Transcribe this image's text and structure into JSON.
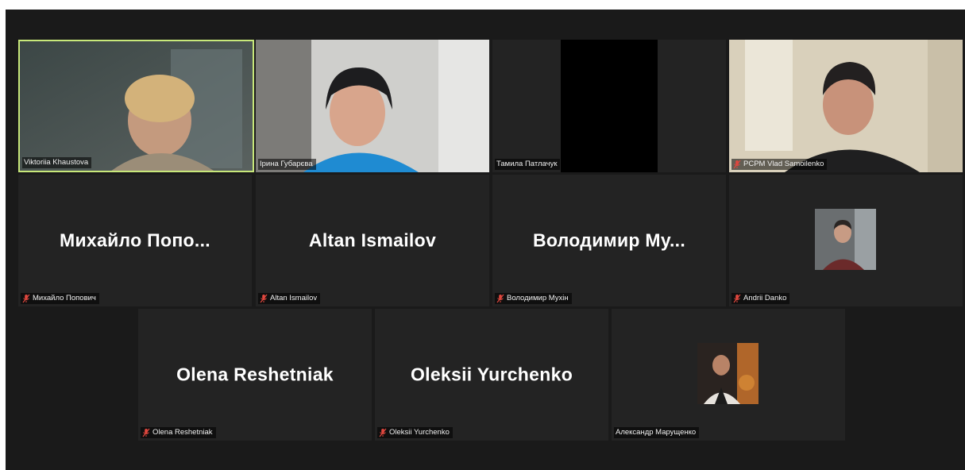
{
  "meeting": {
    "participants": [
      {
        "display": "",
        "label": "Viktoriia Khaustova",
        "muted": false,
        "active_speaker": true,
        "video": true
      },
      {
        "display": "",
        "label": "Ірина Губарєва",
        "muted": false,
        "active_speaker": false,
        "video": true
      },
      {
        "display": "",
        "label": "Тамила Патлачук",
        "muted": false,
        "active_speaker": false,
        "video": true
      },
      {
        "display": "",
        "label": "PCPM Vlad Samoilenko",
        "muted": true,
        "active_speaker": false,
        "video": true
      },
      {
        "display": "Михайло  Попо...",
        "label": "Михайло Попович",
        "muted": true,
        "active_speaker": false,
        "video": false
      },
      {
        "display": "Altan Ismailov",
        "label": "Altan Ismailov",
        "muted": true,
        "active_speaker": false,
        "video": false
      },
      {
        "display": "Володимир  Му...",
        "label": "Володимир Мухін",
        "muted": true,
        "active_speaker": false,
        "video": false
      },
      {
        "display": "",
        "label": "Andrii Danko",
        "muted": true,
        "active_speaker": false,
        "video": false,
        "avatar": "profile-photo"
      },
      {
        "display": "Olena Reshetniak",
        "label": "Olena Reshetniak",
        "muted": true,
        "active_speaker": false,
        "video": false
      },
      {
        "display": "Oleksii Yurchenko",
        "label": "Oleksii Yurchenko",
        "muted": true,
        "active_speaker": false,
        "video": false
      },
      {
        "display": "",
        "label": "Александр Марущенко",
        "muted": false,
        "active_speaker": false,
        "video": false,
        "avatar": "profile-photo"
      }
    ]
  },
  "colors": {
    "background": "#1a1a1a",
    "tile": "#232323",
    "active_border": "#c8e87a",
    "muted_icon": "#e0473e"
  },
  "icons": {
    "muted": "microphone-muted-icon"
  }
}
